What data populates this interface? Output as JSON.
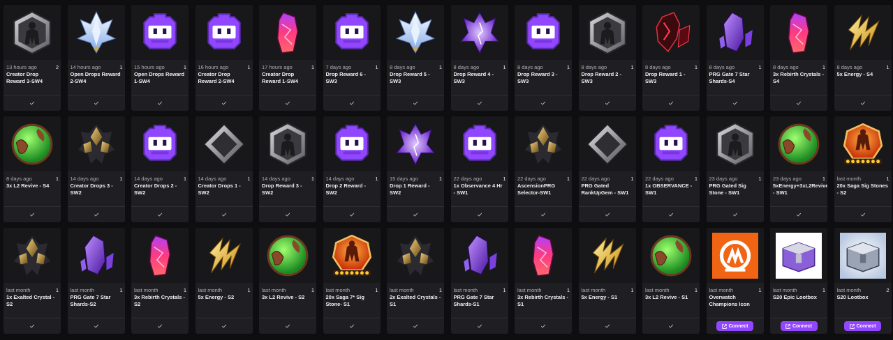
{
  "icons_legend": [
    "hex-armor-icon",
    "ice-crystal-icon",
    "twitch-glitch-icon",
    "red-crystal-icon",
    "purple-crystal-icon",
    "diamond-gem-icon",
    "dark-red-shard-icon",
    "purple-shards-icon",
    "gold-energy-icon",
    "green-orb-icon",
    "gold-crystal-icon",
    "saga-badge-icon",
    "overwatch-logo-icon",
    "purple-lootbox-icon",
    "silver-lootbox-icon"
  ],
  "check_symbol": "✓",
  "rewards": [
    {
      "icon": "hex-armor-icon",
      "time": "13 hours ago",
      "count": "2",
      "title": "Creator Drop Reward 3-SW4",
      "action": "check"
    },
    {
      "icon": "ice-crystal-icon",
      "time": "14 hours ago",
      "count": "1",
      "title": "Open Drops Reward 2-SW4",
      "action": "check"
    },
    {
      "icon": "twitch-glitch-icon",
      "time": "15 hours ago",
      "count": "1",
      "title": "Open Drops Reward 1-SW4",
      "action": "check"
    },
    {
      "icon": "twitch-glitch-icon",
      "time": "16 hours ago",
      "count": "1",
      "title": "Creator Drop Reward 2-SW4",
      "action": "check"
    },
    {
      "icon": "red-crystal-icon",
      "time": "17 hours ago",
      "count": "1",
      "title": "Creator Drop Reward 1-SW4",
      "action": "check"
    },
    {
      "icon": "twitch-glitch-icon",
      "time": "7 days ago",
      "count": "1",
      "title": "Drop Reward 6 - SW3",
      "action": "check"
    },
    {
      "icon": "ice-crystal-icon",
      "time": "8 days ago",
      "count": "1",
      "title": "Drop Reward 5 - SW3",
      "action": "check"
    },
    {
      "icon": "purple-crystal-icon",
      "time": "8 days ago",
      "count": "1",
      "title": "Drop Reward 4 - SW3",
      "action": "check"
    },
    {
      "icon": "twitch-glitch-icon",
      "time": "8 days ago",
      "count": "1",
      "title": "Drop Reward 3 - SW3",
      "action": "check"
    },
    {
      "icon": "hex-armor-icon",
      "time": "8 days ago",
      "count": "1",
      "title": "Drop Reward 2 - SW3",
      "action": "check"
    },
    {
      "icon": "dark-red-shard-icon",
      "time": "8 days ago",
      "count": "1",
      "title": "Drop Reward 1 - SW3",
      "action": "check"
    },
    {
      "icon": "purple-shards-icon",
      "time": "8 days ago",
      "count": "1",
      "title": "PRG Gate 7 Star Shards-S4",
      "action": "check"
    },
    {
      "icon": "red-crystal-icon",
      "time": "8 days ago",
      "count": "1",
      "title": "3x Rebirth Crystals - S4",
      "action": "check"
    },
    {
      "icon": "gold-energy-icon",
      "time": "8 days ago",
      "count": "1",
      "title": "5x Energy - S4",
      "action": "check"
    },
    {
      "icon": "green-orb-icon",
      "time": "8 days ago",
      "count": "1",
      "title": "3x L2 Revive - S4",
      "action": "check"
    },
    {
      "icon": "gold-crystal-icon",
      "time": "14 days ago",
      "count": "1",
      "title": "Creator Drops 3 - SW2",
      "action": "check"
    },
    {
      "icon": "twitch-glitch-icon",
      "time": "14 days ago",
      "count": "1",
      "title": "Creator Drops 2 - SW2",
      "action": "check"
    },
    {
      "icon": "diamond-gem-icon",
      "time": "14 days ago",
      "count": "1",
      "title": "Creator Drops 1 - SW2",
      "action": "check"
    },
    {
      "icon": "hex-armor-icon",
      "time": "14 days ago",
      "count": "1",
      "title": "Drop Reward 3 - SW2",
      "action": "check"
    },
    {
      "icon": "twitch-glitch-icon",
      "time": "14 days ago",
      "count": "1",
      "title": "Drop 2 Reward - SW2",
      "action": "check"
    },
    {
      "icon": "purple-crystal-icon",
      "time": "15 days ago",
      "count": "1",
      "title": "Drop 1 Reward - SW2",
      "action": "check"
    },
    {
      "icon": "twitch-glitch-icon",
      "time": "22 days ago",
      "count": "1",
      "title": "1x Observance 4 Hr - SW1",
      "action": "check"
    },
    {
      "icon": "gold-crystal-icon",
      "time": "22 days ago",
      "count": "1",
      "title": "AscensionPRG Selector-SW1",
      "action": "check"
    },
    {
      "icon": "diamond-gem-icon",
      "time": "22 days ago",
      "count": "1",
      "title": "PRG Gated RankUpGem - SW1",
      "action": "check"
    },
    {
      "icon": "twitch-glitch-icon",
      "time": "22 days ago",
      "count": "1",
      "title": "1x OBSERVANCE - SW1",
      "action": "check"
    },
    {
      "icon": "hex-armor-icon",
      "time": "23 days ago",
      "count": "1",
      "title": "PRG Gated Sig Stone - SW1",
      "action": "check"
    },
    {
      "icon": "green-orb-icon",
      "time": "23 days ago",
      "count": "1",
      "title": "5xEnergy+3xL2Revive - SW1",
      "action": "check"
    },
    {
      "icon": "saga-badge-icon",
      "time": "last month",
      "count": "1",
      "title": "20x Saga Sig Stones - S2",
      "action": "check"
    },
    {
      "icon": "gold-crystal-icon",
      "time": "last month",
      "count": "1",
      "title": "1x Exalted Crystal - S2",
      "action": "check"
    },
    {
      "icon": "purple-shards-icon",
      "time": "last month",
      "count": "1",
      "title": "PRG Gate 7 Star Shards-S2",
      "action": "check"
    },
    {
      "icon": "red-crystal-icon",
      "time": "last month",
      "count": "1",
      "title": "3x Rebirth Crystals - S2",
      "action": "check"
    },
    {
      "icon": "gold-energy-icon",
      "time": "last month",
      "count": "1",
      "title": "5x Energy - S2",
      "action": "check"
    },
    {
      "icon": "green-orb-icon",
      "time": "last month",
      "count": "1",
      "title": "3x L2 Revive - S2",
      "action": "check"
    },
    {
      "icon": "saga-badge-icon",
      "time": "last month",
      "count": "1",
      "title": "20x Saga 7* Sig Stone- S1",
      "action": "check"
    },
    {
      "icon": "gold-crystal-icon",
      "time": "last month",
      "count": "1",
      "title": "2x Exalted Crystals - S1",
      "action": "check"
    },
    {
      "icon": "purple-shards-icon",
      "time": "last month",
      "count": "1",
      "title": "PRG Gate 7 Star Shards-S1",
      "action": "check"
    },
    {
      "icon": "red-crystal-icon",
      "time": "last month",
      "count": "1",
      "title": "3x Rebirth Crystals - S1",
      "action": "check"
    },
    {
      "icon": "gold-energy-icon",
      "time": "last month",
      "count": "1",
      "title": "5x Energy - S1",
      "action": "check"
    },
    {
      "icon": "green-orb-icon",
      "time": "last month",
      "count": "1",
      "title": "3x L2 Revive - S1",
      "action": "check"
    },
    {
      "icon": "overwatch-logo-icon",
      "time": "last month",
      "count": "1",
      "title": "Overwatch Champions Icon",
      "action": "connect",
      "connect_label": "Connect"
    },
    {
      "icon": "purple-lootbox-icon",
      "time": "last month",
      "count": "1",
      "title": "S20 Epic Lootbox",
      "action": "connect",
      "connect_label": "Connect"
    },
    {
      "icon": "silver-lootbox-icon",
      "time": "last month",
      "count": "2",
      "title": "S20 Lootbox",
      "action": "connect",
      "connect_label": "Connect"
    }
  ]
}
